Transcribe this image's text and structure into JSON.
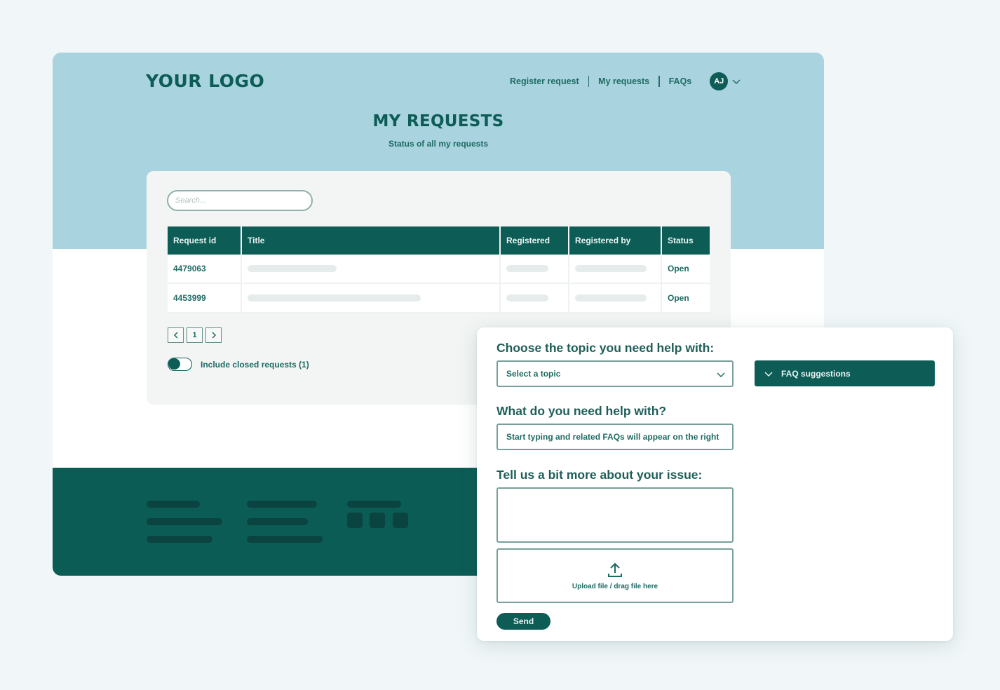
{
  "site": {
    "logo": "YOUR LOGO",
    "nav": {
      "items": [
        {
          "label": "Register request"
        },
        {
          "label": "My requests"
        },
        {
          "label": "FAQs"
        }
      ],
      "avatar_initials": "AJ"
    },
    "page_title": "MY REQUESTS",
    "page_subtitle": "Status of all my requests",
    "search": {
      "placeholder": "Search..."
    },
    "table": {
      "columns": [
        "Request id",
        "Title",
        "Registered",
        "Registered by",
        "Status"
      ],
      "rows": [
        {
          "id": "4479063",
          "status": "Open"
        },
        {
          "id": "4453999",
          "status": "Open"
        }
      ]
    },
    "pagination": {
      "prev": "‹",
      "current": "1",
      "next": "›"
    },
    "toggle": {
      "label": "Include closed requests (1)",
      "checked": false
    }
  },
  "form": {
    "topic_question": "Choose the topic you need help with:",
    "topic_select": {
      "value": "Select a topic"
    },
    "faq_button": "FAQ suggestions",
    "help_question": "What do you need help with?",
    "help_input": {
      "placeholder": "Start typing and  related FAQs will appear on the right"
    },
    "issue_question": "Tell us a bit more about your issue:",
    "issue_textarea": {
      "value": ""
    },
    "upload_label": "Upload file / drag file here",
    "send_button": "Send"
  },
  "colors": {
    "primary": "#0d5c56",
    "hero_bg": "#a8d3df",
    "page_bg": "#f1f7f9",
    "footer_placeholder": "#0a433f"
  }
}
